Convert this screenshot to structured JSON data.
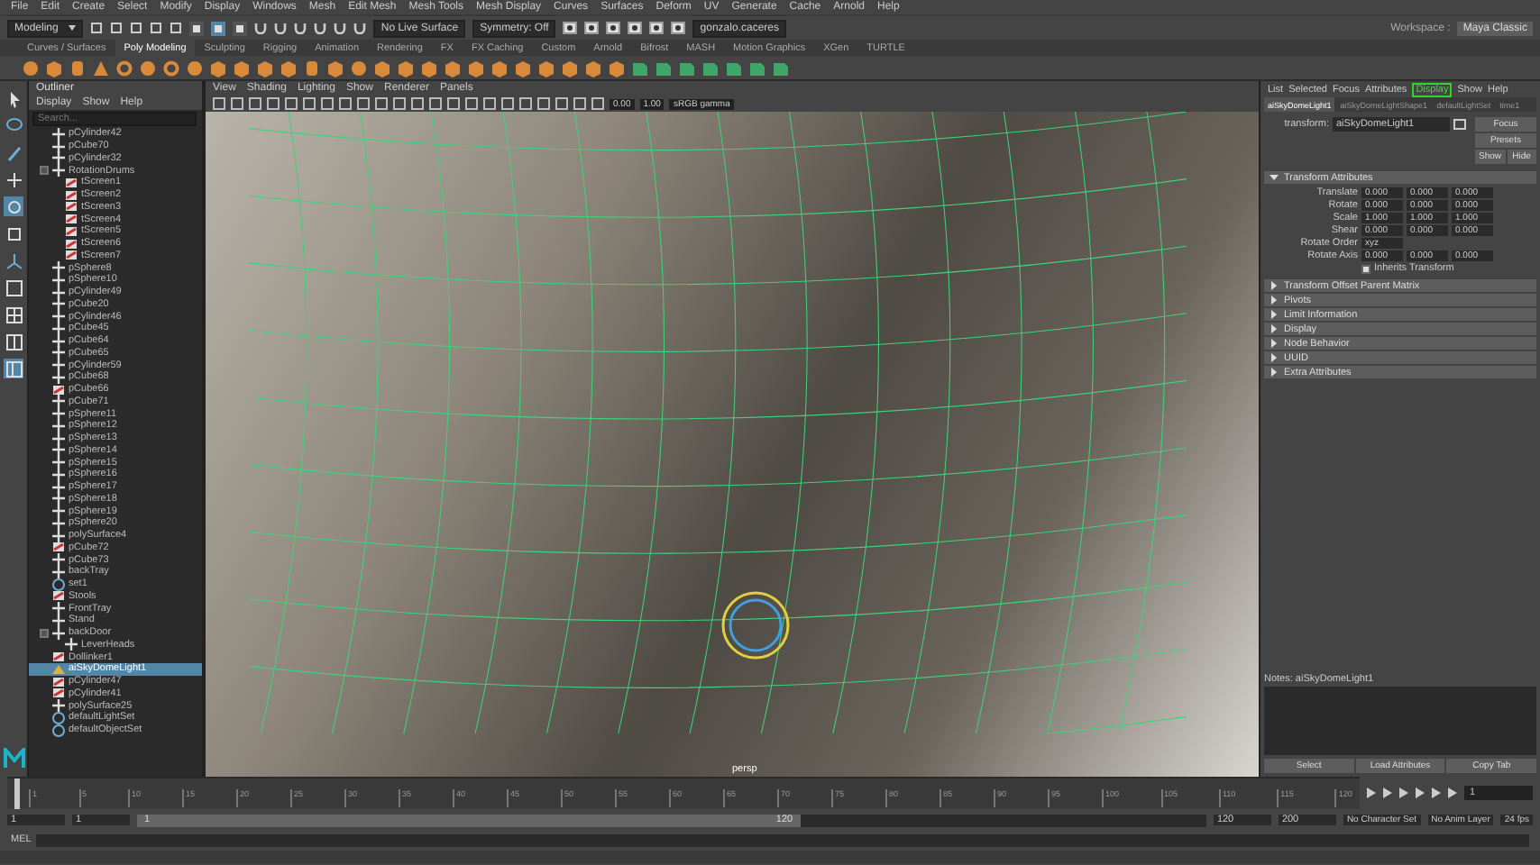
{
  "menu_bar": [
    "File",
    "Edit",
    "Create",
    "Select",
    "Modify",
    "Display",
    "Windows",
    "Mesh",
    "Edit Mesh",
    "Mesh Tools",
    "Mesh Display",
    "Curves",
    "Surfaces",
    "Deform",
    "UV",
    "Generate",
    "Cache",
    "Arnold",
    "Help"
  ],
  "status_line": {
    "mode": "Modeling",
    "live_surface": "No Live Surface",
    "symmetry": "Symmetry: Off",
    "user": "gonzalo.caceres",
    "workspace_label": "Workspace :",
    "workspace": "Maya Classic"
  },
  "shelf": {
    "tabs": [
      {
        "label": "Curves / Surfaces",
        "selected": false
      },
      {
        "label": "Poly Modeling",
        "selected": true
      },
      {
        "label": "Sculpting",
        "selected": false
      },
      {
        "label": "Rigging",
        "selected": false
      },
      {
        "label": "Animation",
        "selected": false
      },
      {
        "label": "Rendering",
        "selected": false
      },
      {
        "label": "FX",
        "selected": false
      },
      {
        "label": "FX Caching",
        "selected": false
      },
      {
        "label": "Custom",
        "selected": false
      },
      {
        "label": "Arnold",
        "selected": false
      },
      {
        "label": "Bifrost",
        "selected": false
      },
      {
        "label": "MASH",
        "selected": false
      },
      {
        "label": "Motion Graphics",
        "selected": false
      },
      {
        "label": "XGen",
        "selected": false
      },
      {
        "label": "TURTLE",
        "selected": false
      }
    ]
  },
  "outliner": {
    "title": "Outliner",
    "menu": [
      "Display",
      "Show",
      "Help"
    ],
    "placeholder": "Search...",
    "items": [
      {
        "label": "pCylinder42",
        "kind": "transform",
        "selected": false
      },
      {
        "label": "pCube70",
        "kind": "transform",
        "selected": false
      },
      {
        "label": "pCylinder32",
        "kind": "transform",
        "selected": false
      },
      {
        "label": "RotationDrums",
        "kind": "group",
        "selected": false,
        "expanded": true,
        "children": [
          {
            "label": "tScreen1",
            "kind": "mesh",
            "selected": false
          },
          {
            "label": "tScreen2",
            "kind": "mesh",
            "selected": false
          },
          {
            "label": "tScreen3",
            "kind": "mesh",
            "selected": false
          },
          {
            "label": "tScreen4",
            "kind": "mesh",
            "selected": false
          },
          {
            "label": "tScreen5",
            "kind": "mesh",
            "selected": false
          },
          {
            "label": "tScreen6",
            "kind": "mesh",
            "selected": false
          },
          {
            "label": "tScreen7",
            "kind": "mesh",
            "selected": false
          }
        ]
      },
      {
        "label": "pSphere8",
        "kind": "transform",
        "selected": false
      },
      {
        "label": "pSphere10",
        "kind": "transform",
        "selected": false
      },
      {
        "label": "pCylinder49",
        "kind": "transform",
        "selected": false
      },
      {
        "label": "pCube20",
        "kind": "transform",
        "selected": false
      },
      {
        "label": "pCylinder46",
        "kind": "transform",
        "selected": false
      },
      {
        "label": "pCube45",
        "kind": "transform",
        "selected": false
      },
      {
        "label": "pCube64",
        "kind": "transform",
        "selected": false
      },
      {
        "label": "pCube65",
        "kind": "transform",
        "selected": false
      },
      {
        "label": "pCylinder59",
        "kind": "transform",
        "selected": false
      },
      {
        "label": "pCube68",
        "kind": "transform",
        "selected": false
      },
      {
        "label": "pCube66",
        "kind": "mesh",
        "selected": false
      },
      {
        "label": "pCube71",
        "kind": "transform",
        "selected": false
      },
      {
        "label": "pSphere11",
        "kind": "transform",
        "selected": false
      },
      {
        "label": "pSphere12",
        "kind": "transform",
        "selected": false
      },
      {
        "label": "pSphere13",
        "kind": "transform",
        "selected": false
      },
      {
        "label": "pSphere14",
        "kind": "transform",
        "selected": false
      },
      {
        "label": "pSphere15",
        "kind": "transform",
        "selected": false
      },
      {
        "label": "pSphere16",
        "kind": "transform",
        "selected": false
      },
      {
        "label": "pSphere17",
        "kind": "transform",
        "selected": false
      },
      {
        "label": "pSphere18",
        "kind": "transform",
        "selected": false
      },
      {
        "label": "pSphere19",
        "kind": "transform",
        "selected": false
      },
      {
        "label": "pSphere20",
        "kind": "transform",
        "selected": false
      },
      {
        "label": "polySurface4",
        "kind": "transform",
        "selected": false
      },
      {
        "label": "pCube72",
        "kind": "mesh",
        "selected": false
      },
      {
        "label": "pCube73",
        "kind": "transform",
        "selected": false
      },
      {
        "label": "backTray",
        "kind": "transform",
        "selected": false
      },
      {
        "label": "set1",
        "kind": "set",
        "selected": false
      },
      {
        "label": "Stools",
        "kind": "mesh",
        "selected": false
      },
      {
        "label": "FrontTray",
        "kind": "transform",
        "selected": false
      },
      {
        "label": "Stand",
        "kind": "transform",
        "selected": false
      },
      {
        "label": "backDoor",
        "kind": "group",
        "selected": false,
        "expanded": true,
        "children": [
          {
            "label": "LeverHeads",
            "kind": "transform",
            "selected": false
          }
        ]
      },
      {
        "label": "Dollinker1",
        "kind": "mesh",
        "selected": false
      },
      {
        "label": "aiSkyDomeLight1",
        "kind": "light",
        "selected": true
      },
      {
        "label": "pCylinder47",
        "kind": "mesh",
        "selected": false
      },
      {
        "label": "pCylinder41",
        "kind": "mesh",
        "selected": false
      },
      {
        "label": "polySurface25",
        "kind": "transform",
        "selected": false
      },
      {
        "label": "defaultLightSet",
        "kind": "set",
        "selected": false
      },
      {
        "label": "defaultObjectSet",
        "kind": "set",
        "selected": false
      }
    ]
  },
  "viewport": {
    "menu": [
      "View",
      "Shading",
      "Lighting",
      "Show",
      "Renderer",
      "Panels"
    ],
    "fields": [
      "0.00",
      "1.00"
    ],
    "color_space": "sRGB gamma",
    "camera": "persp"
  },
  "attribute_editor": {
    "menu": [
      {
        "label": "List",
        "highlighted": false
      },
      {
        "label": "Selected",
        "highlighted": false
      },
      {
        "label": "Focus",
        "highlighted": false
      },
      {
        "label": "Attributes",
        "highlighted": false
      },
      {
        "label": "Display",
        "highlighted": true
      },
      {
        "label": "Show",
        "highlighted": false
      },
      {
        "label": "Help",
        "highlighted": false
      }
    ],
    "node_tabs": [
      {
        "label": "aiSkyDomeLight1",
        "selected": true
      },
      {
        "label": "aiSkyDomeLightShape1",
        "selected": false
      },
      {
        "label": "defaultLightSet",
        "selected": false
      },
      {
        "label": "time1",
        "selected": false
      }
    ],
    "node_label": "transform:",
    "node_name": "aiSkyDomeLight1",
    "buttons": [
      "Focus",
      "Presets",
      "Show",
      "Hide"
    ],
    "sections": [
      {
        "label": "Transform Attributes",
        "expanded": true
      },
      {
        "label": "Transform Offset Parent Matrix",
        "expanded": false
      },
      {
        "label": "Pivots",
        "expanded": false
      },
      {
        "label": "Limit Information",
        "expanded": false
      },
      {
        "label": "Display",
        "expanded": false
      },
      {
        "label": "Node Behavior",
        "expanded": false
      },
      {
        "label": "UUID",
        "expanded": false
      },
      {
        "label": "Extra Attributes",
        "expanded": false
      }
    ],
    "attributes": [
      {
        "label": "Translate",
        "values": [
          "0.000",
          "0.000",
          "0.000"
        ]
      },
      {
        "label": "Rotate",
        "values": [
          "0.000",
          "0.000",
          "0.000"
        ]
      },
      {
        "label": "Scale",
        "values": [
          "1.000",
          "1.000",
          "1.000"
        ]
      },
      {
        "label": "Shear",
        "values": [
          "0.000",
          "0.000",
          "0.000"
        ]
      }
    ],
    "rotate_order": {
      "label": "Rotate Order",
      "value": "xyz"
    },
    "rotate_axis": {
      "label": "Rotate Axis",
      "values": [
        "0.000",
        "0.000",
        "0.000"
      ]
    },
    "inherits_transform": {
      "label": "Inherits Transform",
      "checked": true
    },
    "notes": "Notes: aiSkyDomeLight1",
    "footer_buttons": [
      "Select",
      "Load Attributes",
      "Copy Tab"
    ]
  },
  "time_slider": {
    "ticks": [
      "1",
      "5",
      "10",
      "15",
      "20",
      "25",
      "30",
      "35",
      "40",
      "45",
      "50",
      "55",
      "60",
      "65",
      "70",
      "75",
      "80",
      "85",
      "90",
      "95",
      "100",
      "105",
      "110",
      "115",
      "120"
    ],
    "current_frame": "1",
    "level": 0
  },
  "range_slider": {
    "start": "1",
    "range_start": "1",
    "bar_start": "1",
    "bar_end": "120",
    "level": 0.62,
    "range_end": "120",
    "end": "200",
    "character_set": "No Character Set",
    "anim_layer": "No Anim Layer",
    "fps": "24 fps"
  },
  "command_line": {
    "label": "MEL"
  }
}
